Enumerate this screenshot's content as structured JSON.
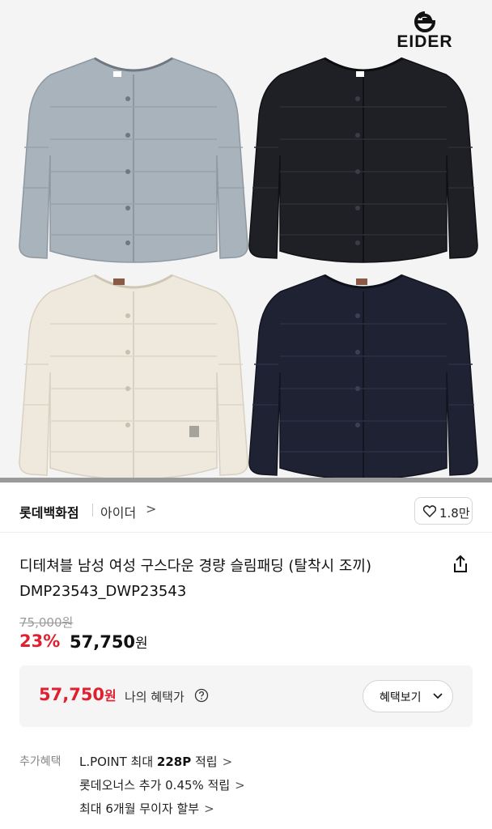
{
  "brand_logo": {
    "text": "EIDER"
  },
  "image_carousel": {
    "progress": 1.0,
    "colors": [
      "#a7b2bb",
      "#1d1f24",
      "#efe9dc",
      "#1f2233"
    ]
  },
  "seller": {
    "store": "롯데백화점",
    "brand": "아이더",
    "chevron": ">",
    "likes": "1.8만"
  },
  "product": {
    "title_line1": "디테쳐블 남성 여성 구스다운 경량 슬림패딩 (탈착시 조끼)",
    "title_line2": "DMP23543_DWP23543"
  },
  "price": {
    "original": "75,000원",
    "discount": "23%",
    "sale": "57,750",
    "sale_unit": "원"
  },
  "benefit": {
    "price": "57,750",
    "unit": "원",
    "label": "나의 혜택가",
    "button": "혜택보기"
  },
  "extra_benefits": {
    "label": "추가혜택",
    "items": [
      {
        "prefix": "L.POINT 최대 ",
        "bold": "228P",
        "suffix": " 적립",
        "chevron": ">"
      },
      {
        "prefix": "롯데오너스 추가 0.45% 적립",
        "bold": "",
        "suffix": "",
        "chevron": ">"
      },
      {
        "prefix": "최대 6개월 무이자 할부",
        "bold": "",
        "suffix": "",
        "chevron": ">"
      }
    ]
  },
  "colors": {
    "accent_red": "#e0202e",
    "text": "#111111",
    "muted": "#9a9a9a"
  }
}
